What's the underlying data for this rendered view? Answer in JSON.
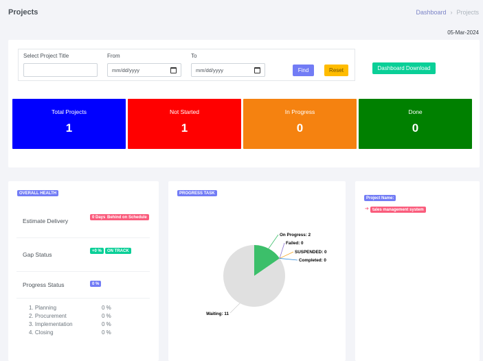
{
  "header": {
    "title": "Projects",
    "breadcrumb": [
      "Dashboard",
      "Projects"
    ],
    "breadcrumb_separator": "›",
    "date": "05-Mar-2024"
  },
  "filters": {
    "project_title_label": "Select Project Title",
    "project_title_value": "",
    "from_label": "From",
    "from_placeholder": "mm/dd/yyyy",
    "to_label": "To",
    "to_placeholder": "mm/dd/yyyy",
    "find_label": "Find",
    "reset_label": "Reset",
    "download_label": "Dashboard Download"
  },
  "stats": [
    {
      "label": "Total Projects",
      "value": "1",
      "color": "#0000ff"
    },
    {
      "label": "Not Started",
      "value": "1",
      "color": "#ff0000"
    },
    {
      "label": "In Progress",
      "value": "0",
      "color": "#f58210"
    },
    {
      "label": "Done",
      "value": "0",
      "color": "#008000"
    }
  ],
  "health": {
    "title": "OVERALL HEALTH",
    "estimate_label": "Estimate Delivery",
    "estimate_badges": [
      "0 Days",
      "Behind on Schedule"
    ],
    "gap_label": "Gap Status",
    "gap_badges": [
      "+0 %",
      "ON TRACK"
    ],
    "progress_label": "Progress Status",
    "progress_badge": "0 %",
    "phases": [
      {
        "name": "1. Planning",
        "value": "0 %"
      },
      {
        "name": "2. Procurement",
        "value": "0 %"
      },
      {
        "name": "3. Implementation",
        "value": "0 %"
      },
      {
        "name": "4. Closing",
        "value": "0 %"
      }
    ]
  },
  "progress_task": {
    "title": "PROGRESS TASK"
  },
  "chart_data": {
    "type": "pie",
    "slices": [
      {
        "label": "On Progress",
        "value": 2,
        "color": "#3cbf6a"
      },
      {
        "label": "Failed",
        "value": 0,
        "color": "#8a6fd1"
      },
      {
        "label": "SUSPENDED",
        "value": 0,
        "color": "#f5a623"
      },
      {
        "label": "Completed",
        "value": 0,
        "color": "#2f8cdb"
      },
      {
        "label": "Waiting",
        "value": 11,
        "color": "#e0e0e0"
      }
    ],
    "label_format": "{label}: {value}"
  },
  "project": {
    "title": "Project Name:",
    "items": [
      "tales management system"
    ],
    "arrow_icon": "arrow-right-icon"
  }
}
